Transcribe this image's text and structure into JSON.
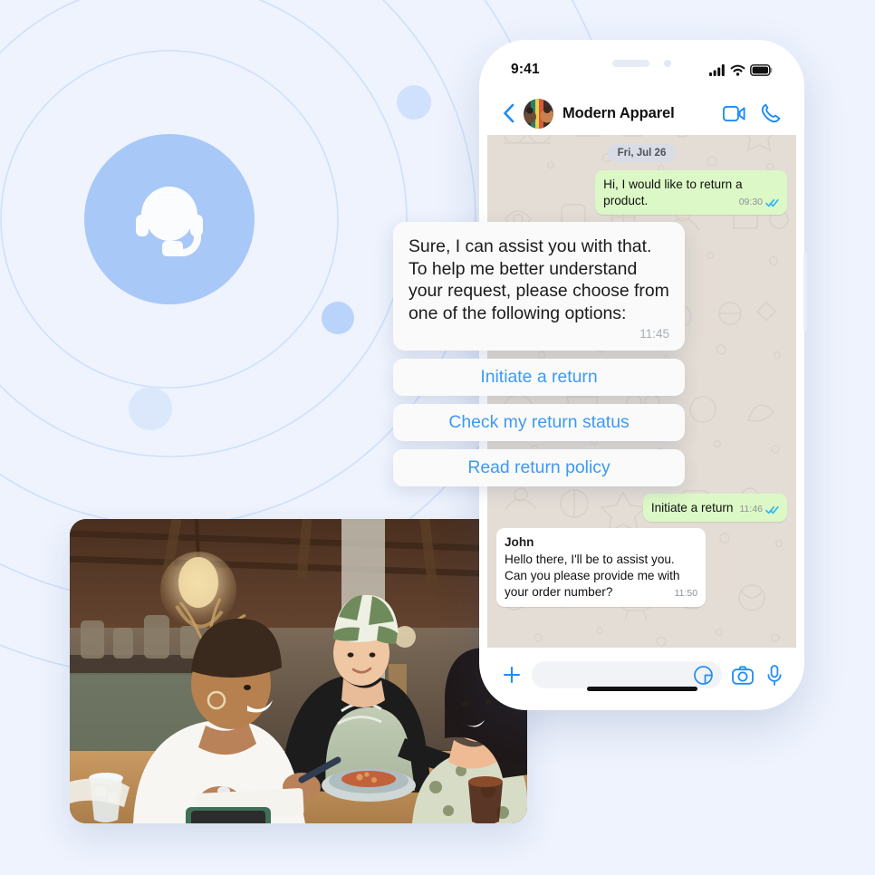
{
  "theme": {
    "page_background": "#eef3fd",
    "accent_blue": "#3c9af5",
    "badge_circle": "#a8c8f8",
    "chat_wallpaper": "#e4ddd5",
    "outgoing_bubble": "#dcf8c6",
    "incoming_bubble": "#ffffff",
    "tick_blue": "#34b7f1"
  },
  "badge": {
    "icon": "headset-support-icon"
  },
  "photo": {
    "alt": "Three women at a restaurant table, a server in a striped beanie and apron leaning in to talk with two seated customers"
  },
  "phone": {
    "status_bar": {
      "time": "9:41",
      "icons": [
        "cellular-signal-icon",
        "wifi-icon",
        "battery-icon"
      ]
    },
    "header": {
      "back_icon": "chevron-left-icon",
      "avatar": "contact-avatar",
      "contact_name": "Modern Apparel",
      "actions": [
        "video-call-icon",
        "voice-call-icon"
      ]
    },
    "chat": {
      "date_chip": "Fri, Jul 26",
      "messages": [
        {
          "id": "msg-return-request",
          "direction": "out",
          "text": "Hi, I would like to return a product.",
          "time": "09:30",
          "status": "read"
        },
        {
          "id": "msg-initiate-return",
          "direction": "out",
          "text": "Initiate a return",
          "time": "11:46",
          "status": "read",
          "inline": true
        },
        {
          "id": "msg-agent-greeting",
          "direction": "in",
          "sender": "John",
          "text": "Hello there, I'll be to assist you. Can you please provide me with your order number?",
          "time": "11:50"
        }
      ]
    },
    "input_bar": {
      "attach_icon": "plus-icon",
      "placeholder": "",
      "value": "",
      "sticker_icon": "sticker-icon",
      "camera_icon": "camera-icon",
      "mic_icon": "microphone-icon"
    }
  },
  "callout": {
    "message": "Sure, I can assist you with that. To help me better understand your request, please choose from one of the following options:",
    "time": "11:45",
    "options": [
      {
        "id": "option-initiate-return",
        "label": "Initiate a return"
      },
      {
        "id": "option-check-status",
        "label": "Check my return status"
      },
      {
        "id": "option-read-policy",
        "label": "Read return policy"
      }
    ]
  }
}
